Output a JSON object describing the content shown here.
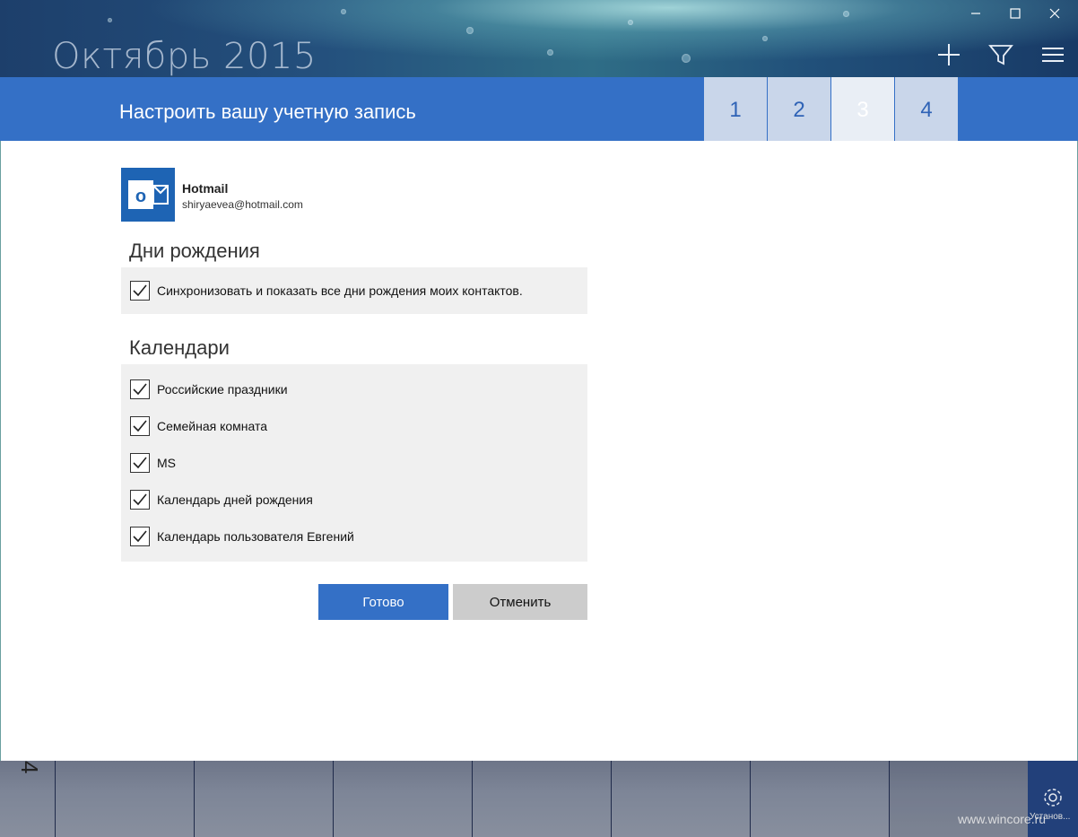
{
  "header": {
    "month_title": "Октябрь 2015",
    "window_controls": [
      "minimize-icon",
      "maximize-icon",
      "close-icon"
    ],
    "actions": [
      "add-icon",
      "filter-icon",
      "menu-icon"
    ]
  },
  "wizard": {
    "title": "Настроить вашу учетную запись",
    "steps": [
      "1",
      "2",
      "3",
      "4"
    ],
    "active_step": "3"
  },
  "account": {
    "name": "Hotmail",
    "email": "shiryaevea@hotmail.com",
    "icon": "outlook-icon"
  },
  "birthdays": {
    "title": "Дни рождения",
    "option": {
      "label": "Синхронизовать и показать все дни рождения моих контактов.",
      "checked": true
    }
  },
  "calendars": {
    "title": "Календари",
    "items": [
      {
        "label": "Российские праздники",
        "checked": true
      },
      {
        "label": "Семейная комната",
        "checked": true
      },
      {
        "label": "MS",
        "checked": true
      },
      {
        "label": "Календарь дней рождения",
        "checked": true
      },
      {
        "label": "Календарь пользователя Евгений",
        "checked": true
      }
    ]
  },
  "buttons": {
    "done": "Готово",
    "cancel": "Отменить"
  },
  "bottom": {
    "day_number": "4",
    "settings_label": "Установ...",
    "watermark": "www.wincore.ru"
  },
  "colors": {
    "accent": "#3470c6",
    "step_bg": "#c9d6ea",
    "panel_bg": "#f0f0f0"
  }
}
